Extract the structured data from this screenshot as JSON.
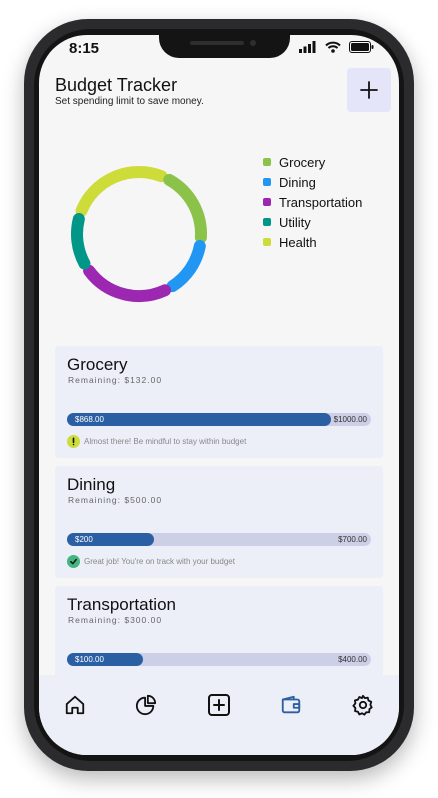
{
  "status_bar": {
    "time": "8:15"
  },
  "header": {
    "title": "Budget Tracker",
    "subtitle": "Set spending limit to save money.",
    "add_icon": "plus-icon"
  },
  "chart_data": {
    "type": "pie",
    "variant": "donut",
    "categories": [
      "Grocery",
      "Dining",
      "Transportation",
      "Utility",
      "Health"
    ],
    "values": [
      20,
      15,
      24,
      14,
      27
    ],
    "colors": [
      "#8bc34a",
      "#2196f3",
      "#9c27b0",
      "#009688",
      "#cddc39"
    ],
    "legend_position": "right"
  },
  "budgets": [
    {
      "name": "Grocery",
      "remaining": "Remaining: $132.00",
      "spent": "$868.00",
      "limit": "$1000.00",
      "progress": 0.868,
      "status": "warning",
      "status_icon": "exclamation-icon",
      "status_color": "#cddc39",
      "message": "Almost there! Be mindful to stay within budget"
    },
    {
      "name": "Dining",
      "remaining": "Remaining: $500.00",
      "spent": "$200",
      "limit": "$700.00",
      "progress": 0.2857,
      "status": "ok",
      "status_icon": "check-icon",
      "status_color": "#43b581",
      "message": "Great job! You're on track with your budget"
    },
    {
      "name": "Transportation",
      "remaining": "Remaining: $300.00",
      "spent": "$100.00",
      "limit": "$400.00",
      "progress": 0.25,
      "status": "ok",
      "status_icon": "check-icon",
      "status_color": "#43b581",
      "message": ""
    }
  ],
  "bottom_nav": {
    "items": [
      {
        "icon": "home-icon",
        "active": false
      },
      {
        "icon": "pie-chart-icon",
        "active": false
      },
      {
        "icon": "add-square-icon",
        "active": false
      },
      {
        "icon": "wallet-icon",
        "active": true
      },
      {
        "icon": "settings-icon",
        "active": false
      }
    ],
    "active_color": "#2b5fa3"
  }
}
